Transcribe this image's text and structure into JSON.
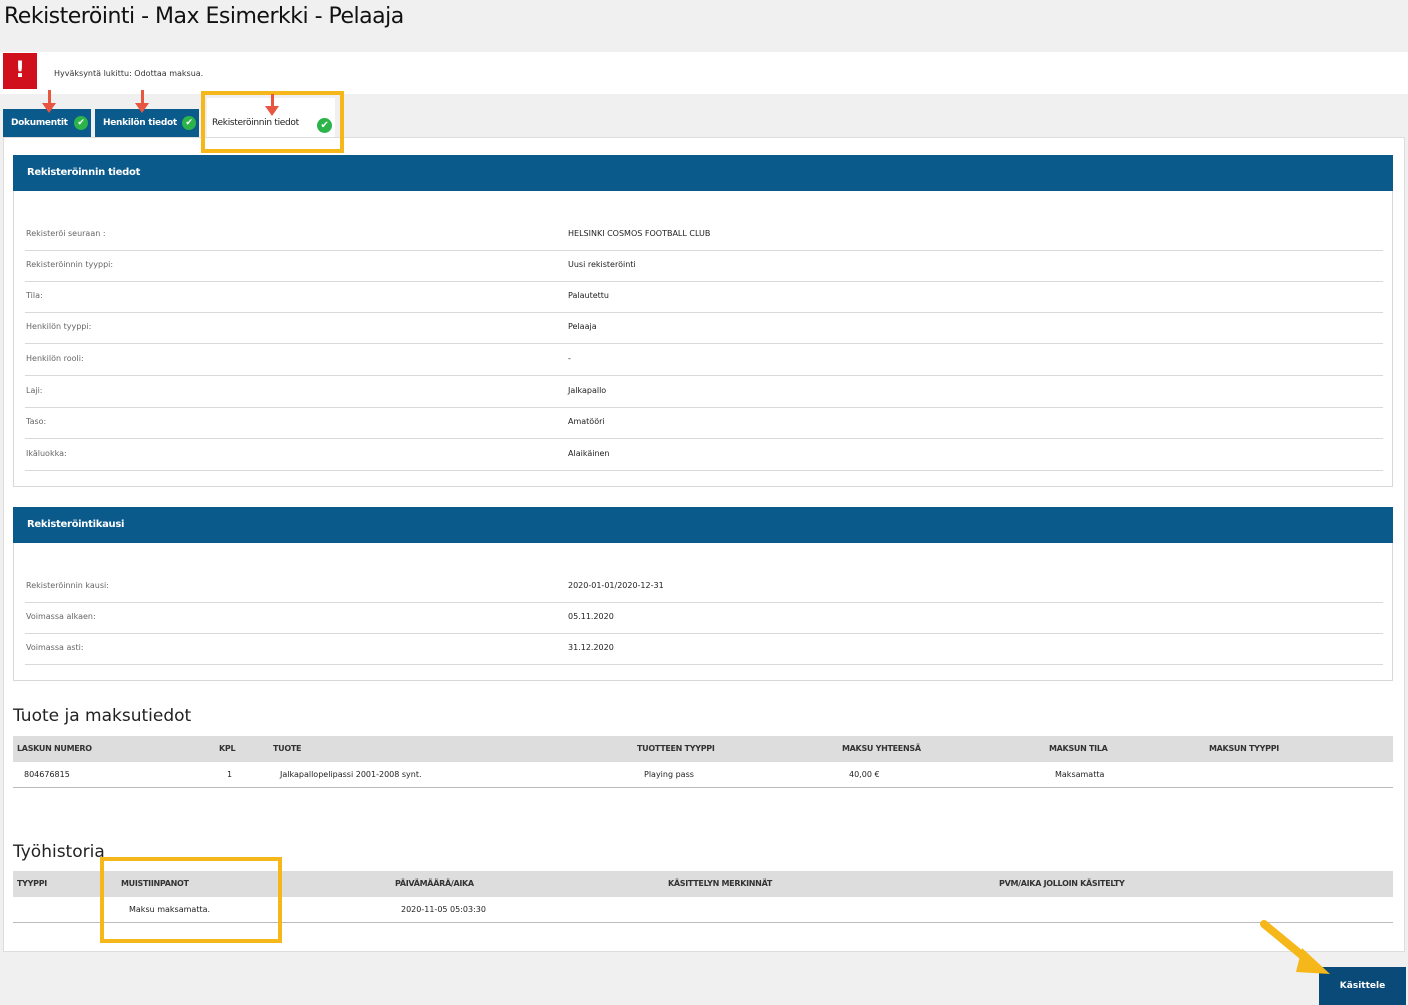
{
  "page": {
    "title": "Rekisteröinti - Max Esimerkki - Pelaaja"
  },
  "alert": {
    "icon": "!",
    "text": "Hyväksyntä lukittu: Odottaa maksua."
  },
  "tabs": [
    {
      "label": "Dokumentit"
    },
    {
      "label": "Henkilön tiedot"
    },
    {
      "label": "Rekisteröinnin tiedot"
    }
  ],
  "icons": {
    "check": "✔",
    "alert": "exclamation-icon"
  },
  "registration": {
    "header": "Rekisteröinnin tiedot",
    "fields": [
      {
        "label": "Rekisteröi seuraan :",
        "value": "HELSINKI COSMOS FOOTBALL CLUB"
      },
      {
        "label": "Rekisteröinnin tyyppi:",
        "value": "Uusi rekisteröinti"
      },
      {
        "label": "Tila:",
        "value": "Palautettu"
      },
      {
        "label": "Henkilön tyyppi:",
        "value": "Pelaaja"
      },
      {
        "label": "Henkilön rooli:",
        "value": "-"
      },
      {
        "label": "Laji:",
        "value": "Jalkapallo"
      },
      {
        "label": "Taso:",
        "value": "Amatööri"
      },
      {
        "label": "Ikäluokka:",
        "value": "Alaikäinen"
      }
    ]
  },
  "period": {
    "header": "Rekisteröintikausi",
    "fields": [
      {
        "label": "Rekisteröinnin kausi:",
        "value": "2020-01-01/2020-12-31"
      },
      {
        "label": "Voimassa alkaen:",
        "value": "05.11.2020"
      },
      {
        "label": "Voimassa asti:",
        "value": "31.12.2020"
      }
    ]
  },
  "products": {
    "title": "Tuote ja maksutiedot",
    "columns": [
      "LASKUN NUMERO",
      "KPL",
      "TUOTE",
      "TUOTTEEN TYYPPI",
      "MAKSU YHTEENSÄ",
      "MAKSUN TILA",
      "MAKSUN TYYPPI"
    ],
    "rows": [
      [
        "804676815",
        "1",
        "Jalkapallopelipassi 2001-2008 synt.",
        "Playing pass",
        "40,00 €",
        "Maksamatta",
        ""
      ]
    ]
  },
  "history": {
    "title": "Työhistoria",
    "columns": [
      "TYYPPI",
      "MUISTIINPANOT",
      "PÄIVÄMÄÄRÄ/AIKA",
      "KÄSITTELYN MERKINNÄT",
      "PVM/AIKA JOLLOIN KÄSITELTY"
    ],
    "rows": [
      [
        "",
        "Maksu maksamatta.",
        "2020-11-05 05:03:30",
        "",
        ""
      ]
    ]
  },
  "actions": {
    "process_label": "Käsittele"
  },
  "colors": {
    "primary": "#0a5a8c",
    "alert": "#d0101d",
    "success": "#2cb34a",
    "highlight": "#f5b71a",
    "annotation_arrow": "#e85540"
  }
}
